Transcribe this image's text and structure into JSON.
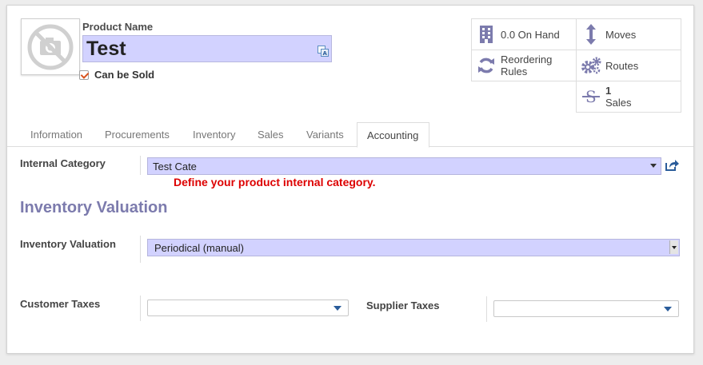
{
  "header": {
    "product_name_label": "Product Name",
    "product_name_value": "Test",
    "can_be_sold_label": "Can be Sold",
    "can_be_sold_checked": true
  },
  "smart_buttons": {
    "on_hand": "0.0 On Hand",
    "moves": "Moves",
    "reordering_rules": "Reordering Rules",
    "routes": "Routes",
    "sales_count": "1",
    "sales_label": "Sales"
  },
  "tabs": [
    {
      "label": "Information",
      "active": false
    },
    {
      "label": "Procurements",
      "active": false
    },
    {
      "label": "Inventory",
      "active": false
    },
    {
      "label": "Sales",
      "active": false
    },
    {
      "label": "Variants",
      "active": false
    },
    {
      "label": "Accounting",
      "active": true
    }
  ],
  "accounting": {
    "internal_category_label": "Internal Category",
    "internal_category_value": "Test Cate",
    "internal_category_hint": "Define your product internal category.",
    "section_title": "Inventory Valuation",
    "inventory_valuation_label": "Inventory Valuation",
    "inventory_valuation_value": "Periodical (manual)",
    "customer_taxes_label": "Customer Taxes",
    "customer_taxes_value": "",
    "supplier_taxes_label": "Supplier Taxes",
    "supplier_taxes_value": ""
  },
  "colors": {
    "required_field_bg": "#d2d2ff",
    "hint_red": "#dd0000",
    "section_title": "#7c7bad",
    "icon_purple": "#7c7bad"
  },
  "icons": [
    "no-image-camera-icon",
    "translate-icon",
    "building-icon",
    "moves-arrow-icon",
    "refresh-icon",
    "gears-icon",
    "strikethrough-s-icon",
    "external-link-icon",
    "chevron-down-icon"
  ]
}
